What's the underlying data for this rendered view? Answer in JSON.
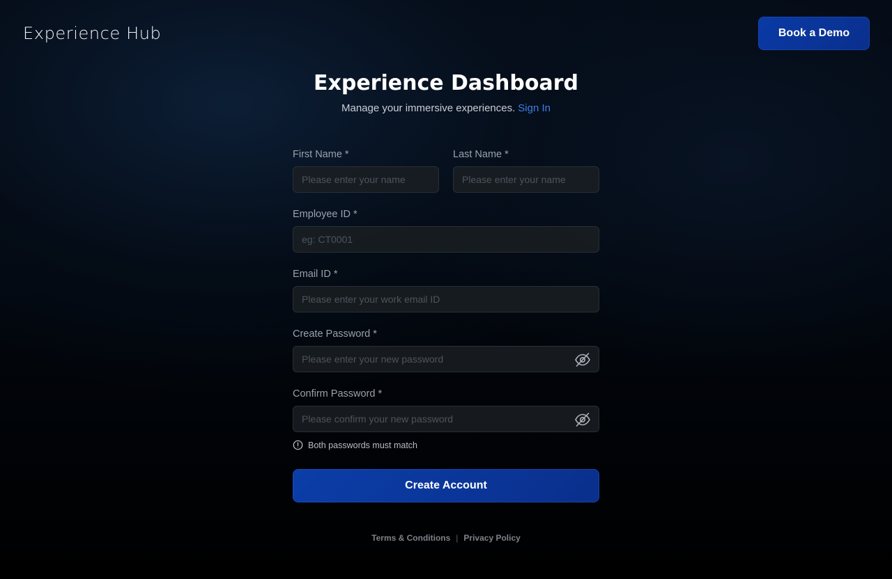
{
  "header": {
    "logo_text": "Experience Hub",
    "demo_button": "Book a Demo"
  },
  "main": {
    "title": "Experience Dashboard",
    "subtitle": "Manage your immersive experiences.",
    "sign_in_link": "Sign In"
  },
  "form": {
    "first_name": {
      "label": "First Name *",
      "placeholder": "Please enter your name",
      "value": ""
    },
    "last_name": {
      "label": "Last Name *",
      "placeholder": "Please enter your name",
      "value": ""
    },
    "employee_id": {
      "label": "Employee ID *",
      "placeholder": "eg: CT0001",
      "value": ""
    },
    "email": {
      "label": "Email ID *",
      "placeholder": "Please enter your work email ID",
      "value": ""
    },
    "password": {
      "label": "Create Password *",
      "placeholder": "Please enter your new password",
      "value": ""
    },
    "confirm_password": {
      "label": "Confirm Password *",
      "placeholder": "Please confirm your new password",
      "value": ""
    },
    "password_hint": "Both passwords must match",
    "submit_label": "Create Account"
  },
  "icons": {
    "toggle_visibility": "eye-off-icon",
    "hint": "info-icon"
  },
  "colors": {
    "accent": "#0a3aa6",
    "link": "#3a7fe8",
    "background": "#000000"
  },
  "footer": {
    "terms": "Terms & Conditions",
    "separator": "|",
    "privacy": "Privacy Policy"
  }
}
